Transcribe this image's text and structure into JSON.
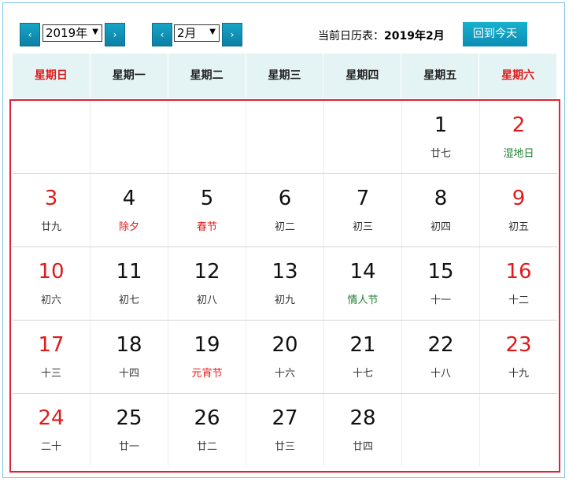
{
  "toolbar": {
    "prev_year": "‹",
    "year_value": "2019年",
    "next_year": "›",
    "prev_month": "‹",
    "month_value": "2月",
    "next_month": "›",
    "current_label": "当前日历表：",
    "current_value": "2019年2月",
    "today_button": "回到今天"
  },
  "weekdays": [
    "星期日",
    "星期一",
    "星期二",
    "星期三",
    "星期四",
    "星期五",
    "星期六"
  ],
  "weeks": [
    [
      null,
      null,
      null,
      null,
      null,
      {
        "day": "1",
        "lunar": "廿七"
      },
      {
        "day": "2",
        "lunar": "湿地日",
        "fest": "green"
      }
    ],
    [
      {
        "day": "3",
        "lunar": "廿九"
      },
      {
        "day": "4",
        "lunar": "除夕",
        "fest": "red"
      },
      {
        "day": "5",
        "lunar": "春节",
        "fest": "red"
      },
      {
        "day": "6",
        "lunar": "初二"
      },
      {
        "day": "7",
        "lunar": "初三"
      },
      {
        "day": "8",
        "lunar": "初四"
      },
      {
        "day": "9",
        "lunar": "初五"
      }
    ],
    [
      {
        "day": "10",
        "lunar": "初六"
      },
      {
        "day": "11",
        "lunar": "初七"
      },
      {
        "day": "12",
        "lunar": "初八"
      },
      {
        "day": "13",
        "lunar": "初九"
      },
      {
        "day": "14",
        "lunar": "情人节",
        "fest": "green"
      },
      {
        "day": "15",
        "lunar": "十一"
      },
      {
        "day": "16",
        "lunar": "十二"
      }
    ],
    [
      {
        "day": "17",
        "lunar": "十三"
      },
      {
        "day": "18",
        "lunar": "十四"
      },
      {
        "day": "19",
        "lunar": "元宵节",
        "fest": "red"
      },
      {
        "day": "20",
        "lunar": "十六"
      },
      {
        "day": "21",
        "lunar": "十七"
      },
      {
        "day": "22",
        "lunar": "十八"
      },
      {
        "day": "23",
        "lunar": "十九"
      }
    ],
    [
      {
        "day": "24",
        "lunar": "二十"
      },
      {
        "day": "25",
        "lunar": "廿一"
      },
      {
        "day": "26",
        "lunar": "廿二"
      },
      {
        "day": "27",
        "lunar": "廿三"
      },
      {
        "day": "28",
        "lunar": "廿四"
      },
      null,
      null
    ]
  ],
  "colors": {
    "accent": "#0b8fb5",
    "weekend": "#e01a1a",
    "festival_green": "#1d7d2e",
    "grid_border": "#e0213a",
    "header_bg": "#e4f4f5"
  }
}
